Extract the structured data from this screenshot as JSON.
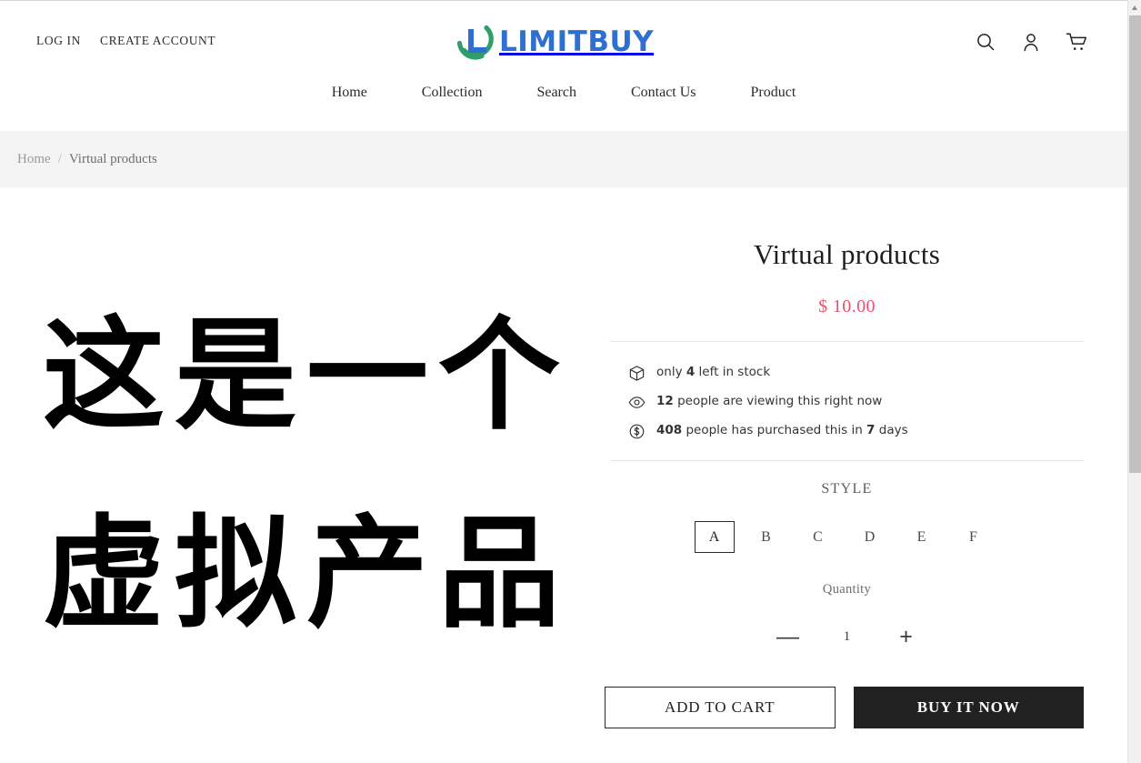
{
  "header": {
    "utility_links": [
      {
        "label": "LOG IN",
        "name": "log-in-link"
      },
      {
        "label": "CREATE ACCOUNT",
        "name": "create-account-link"
      }
    ],
    "logo": {
      "text": "LIMITBUY",
      "mark_color": "#2f9e68",
      "word_color": "#2f6fd0"
    },
    "icons": [
      {
        "name": "search-icon",
        "label": "Search"
      },
      {
        "name": "account-icon",
        "label": "Account"
      },
      {
        "name": "cart-icon",
        "label": "Cart"
      }
    ],
    "nav": [
      {
        "label": "Home"
      },
      {
        "label": "Collection"
      },
      {
        "label": "Search"
      },
      {
        "label": "Contact Us"
      },
      {
        "label": "Product"
      }
    ]
  },
  "breadcrumb": {
    "home": "Home",
    "separator": "/",
    "current": "Virtual products"
  },
  "gallery": {
    "image_line1": "这是一个",
    "image_line2": "虚拟产品"
  },
  "product": {
    "title": "Virtual products",
    "price": "$ 10.00",
    "price_color": "#f0506e",
    "facts": [
      {
        "icon": "package-icon",
        "pre": "only ",
        "strong": "4",
        "post": " left in stock"
      },
      {
        "icon": "eye-icon",
        "pre": "",
        "strong": "12",
        "post": " people are viewing this right now"
      },
      {
        "icon": "dollar-circle-icon",
        "pre": "",
        "strong": "408",
        "mid": " people has purchased this in ",
        "strong2": "7",
        "post": " days"
      }
    ],
    "option": {
      "label": "STYLE",
      "values": [
        "A",
        "B",
        "C",
        "D",
        "E",
        "F"
      ],
      "selected": "A"
    },
    "quantity": {
      "label": "Quantity",
      "value": "1",
      "decrease": "—",
      "increase": "+"
    },
    "actions": {
      "add_to_cart": "ADD TO CART",
      "buy_it_now": "BUY IT NOW"
    }
  }
}
